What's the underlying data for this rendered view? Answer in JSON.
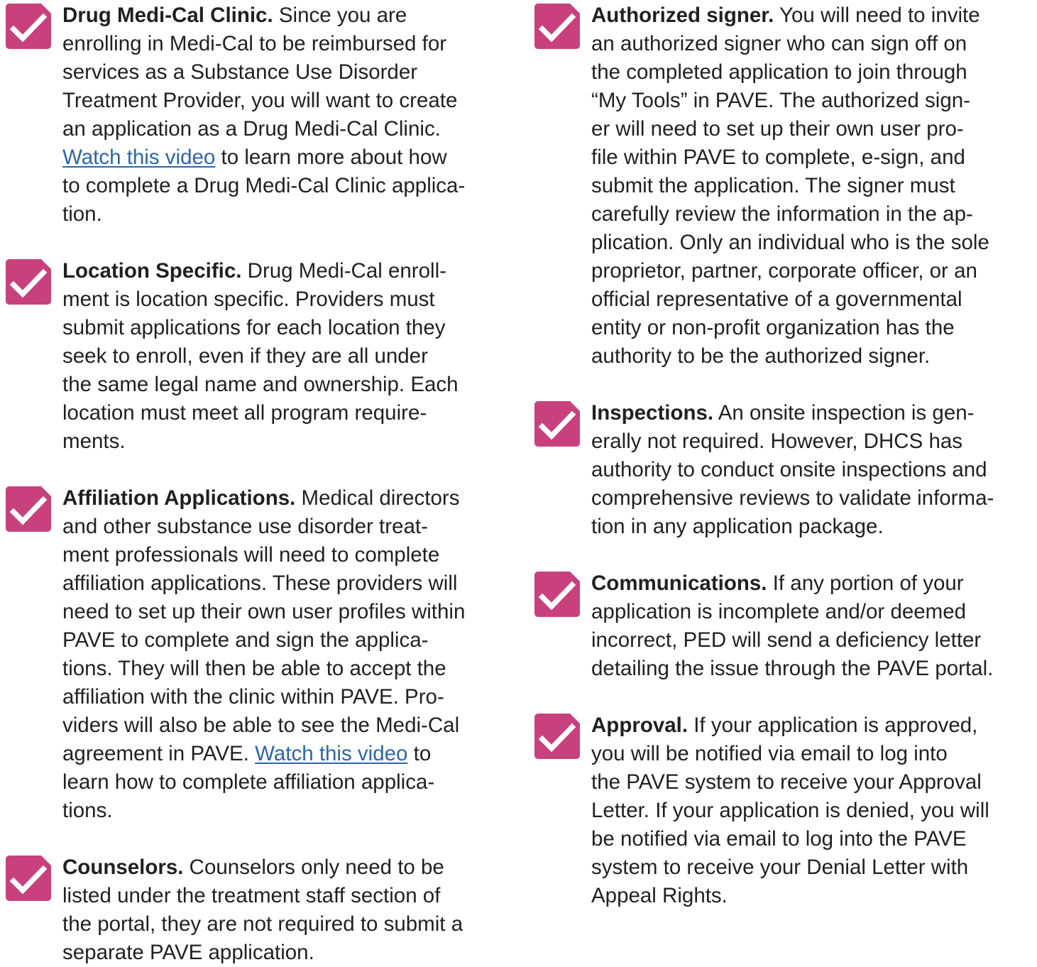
{
  "colors": {
    "checkbox": "#c8417c",
    "check": "#ffffff",
    "text": "#231f20",
    "link": "#2b66ad"
  },
  "icons": {
    "checkbox": "checked-box-icon"
  },
  "left_items": [
    {
      "title": "Drug Medi-Cal Clinic.",
      "body_1": " Since you are",
      "l2": "enrolling in Medi-Cal to be reimbursed for",
      "l3": "services as a Substance Use Disorder",
      "l4": "Treatment Provider, you will want to create",
      "l5": "an application as a Drug Medi-Cal Clinic.",
      "link": "Watch this video",
      "after_link": " to learn more about how",
      "l7": "to complete a Drug Medi-Cal Clinic applica-",
      "l8": "tion."
    },
    {
      "title": "Location Specific.",
      "body_1": " Drug Medi-Cal enroll-",
      "l2": "ment is location specific. Providers must",
      "l3": "submit applications for each location they",
      "l4": "seek to enroll, even if they are all under",
      "l5": "the same legal name and ownership. Each",
      "l6": "location must meet all program require-",
      "l7": "ments."
    },
    {
      "title": "Affiliation Applications.",
      "body_1": " Medical directors",
      "l2": "and other substance use disorder treat-",
      "l3": "ment professionals will need to complete",
      "l4": "affiliation applications. These providers will",
      "l5": "need to set up their own user profiles within",
      "l6": "PAVE to complete and sign the applica-",
      "l7": "tions. They will then be able to accept the",
      "l8": "affiliation with the clinic within PAVE. Pro-",
      "l9": "viders will also be able to see the Medi-Cal",
      "l10_pre": "agreement in PAVE. ",
      "link": "Watch this video",
      "after_link": " to",
      "l11": "learn how to complete affiliation applica-",
      "l12": "tions."
    },
    {
      "title": "Counselors.",
      "body_1": " Counselors only need to be",
      "l2": "listed under the treatment staff section of",
      "l3": "the portal, they are not required to submit a",
      "l4": "separate PAVE application."
    }
  ],
  "right_items": [
    {
      "title": "Authorized signer.",
      "body_1": " You will need to invite",
      "l2": "an authorized signer who can sign off on",
      "l3": "the completed application to join through",
      "l4": "“My Tools” in PAVE. The authorized sign-",
      "l5": "er will need to set up their own user pro-",
      "l6": "file within PAVE to complete, e-sign, and",
      "l7": "submit the application. The signer must",
      "l8": "carefully review the information in the ap-",
      "l9": "plication. Only an individual who is the sole",
      "l10": "proprietor, partner, corporate officer, or an",
      "l11": "official representative of a governmental",
      "l12": "entity or non-profit organization has the",
      "l13": "authority to be the authorized signer."
    },
    {
      "title": "Inspections.",
      "body_1": " An onsite inspection is gen-",
      "l2": "erally not required. However, DHCS has",
      "l3": "authority to conduct onsite inspections and",
      "l4": "comprehensive reviews to validate informa-",
      "l5": "tion in any application package."
    },
    {
      "title": "Communications.",
      "body_1": " If any portion of your",
      "l2": "application is incomplete and/or deemed",
      "l3": "incorrect, PED will send a deficiency letter",
      "l4": "detailing the issue through the PAVE portal."
    },
    {
      "title": "Approval.",
      "body_1": " If your application is approved,",
      "l2": "you will be notified via email to log into",
      "l3": "the PAVE system to receive your Approval",
      "l4": "Letter. If your application is denied, you will",
      "l5": "be notified via email to log into the PAVE",
      "l6": "system to receive your Denial Letter with",
      "l7": "Appeal Rights."
    }
  ]
}
